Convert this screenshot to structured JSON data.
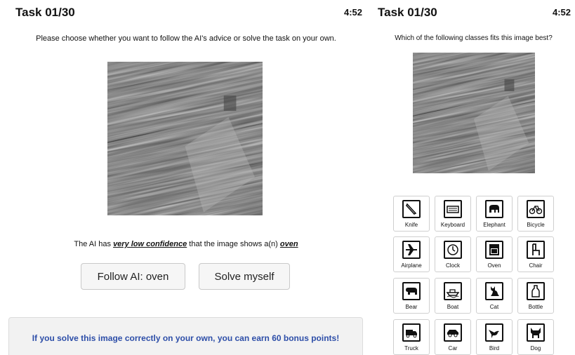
{
  "left_panel": {
    "task_title": "Task 01/30",
    "timer": "4:52",
    "instruction": "Please choose whether you want to follow the AI's advice or solve the task on your own.",
    "ai_message": {
      "prefix": "The AI has ",
      "confidence": "very low confidence",
      "middle": " that the image shows a(n) ",
      "prediction": "oven"
    },
    "follow_button": "Follow AI: oven",
    "solve_button": "Solve myself",
    "bonus_text": "If you solve this image correctly on your own, you can earn 60 bonus points!"
  },
  "right_panel": {
    "task_title": "Task 01/30",
    "timer": "4:52",
    "instruction": "Which of the following classes fits this image best?",
    "classes": [
      {
        "label": "Knife",
        "icon": "knife-icon"
      },
      {
        "label": "Keyboard",
        "icon": "keyboard-icon"
      },
      {
        "label": "Elephant",
        "icon": "elephant-icon"
      },
      {
        "label": "Bicycle",
        "icon": "bicycle-icon"
      },
      {
        "label": "Airplane",
        "icon": "airplane-icon"
      },
      {
        "label": "Clock",
        "icon": "clock-icon"
      },
      {
        "label": "Oven",
        "icon": "oven-icon"
      },
      {
        "label": "Chair",
        "icon": "chair-icon"
      },
      {
        "label": "Bear",
        "icon": "bear-icon"
      },
      {
        "label": "Boat",
        "icon": "boat-icon"
      },
      {
        "label": "Cat",
        "icon": "cat-icon"
      },
      {
        "label": "Bottle",
        "icon": "bottle-icon"
      },
      {
        "label": "Truck",
        "icon": "truck-icon"
      },
      {
        "label": "Car",
        "icon": "car-icon"
      },
      {
        "label": "Bird",
        "icon": "bird-icon"
      },
      {
        "label": "Dog",
        "icon": "dog-icon"
      }
    ]
  }
}
